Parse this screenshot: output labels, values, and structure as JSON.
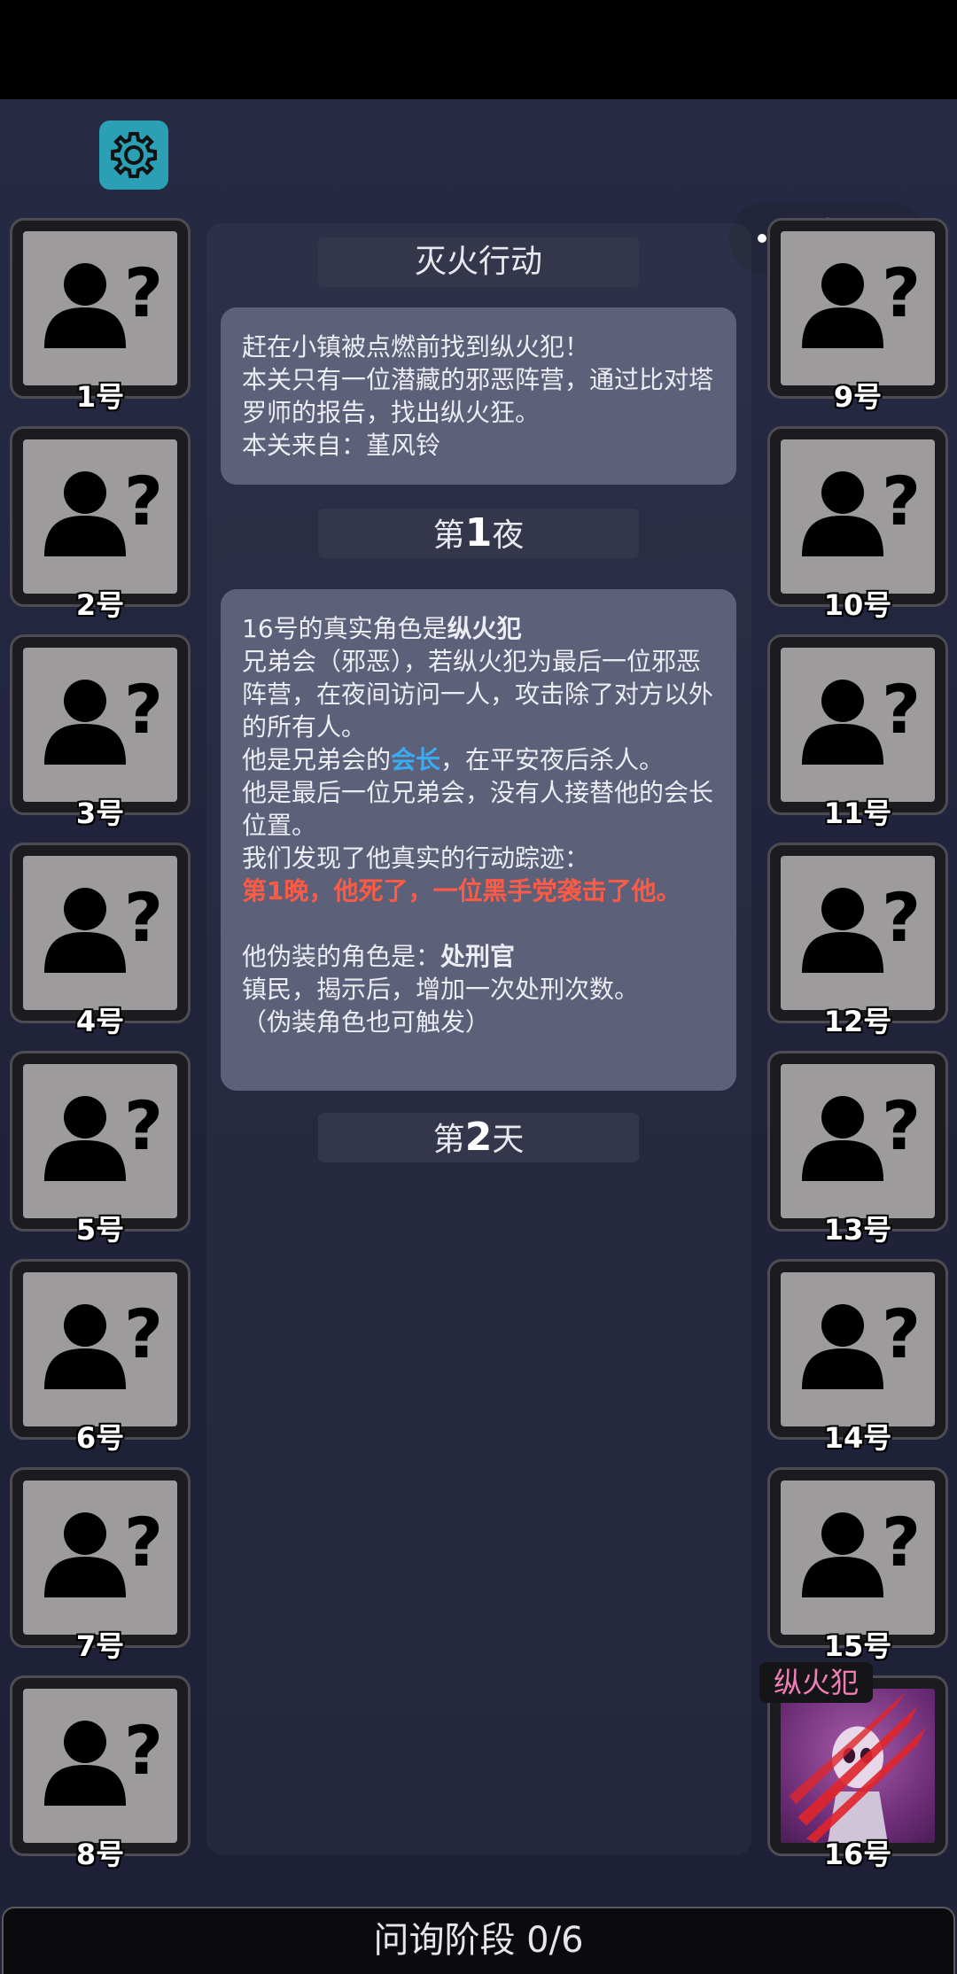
{
  "players_left": [
    {
      "label": "1号"
    },
    {
      "label": "2号"
    },
    {
      "label": "3号"
    },
    {
      "label": "4号"
    },
    {
      "label": "5号"
    },
    {
      "label": "6号"
    },
    {
      "label": "7号"
    },
    {
      "label": "8号"
    }
  ],
  "players_right": [
    {
      "label": "9号"
    },
    {
      "label": "10号"
    },
    {
      "label": "11号"
    },
    {
      "label": "12号"
    },
    {
      "label": "13号"
    },
    {
      "label": "14号"
    },
    {
      "label": "15号"
    },
    {
      "label": "16号",
      "revealed_role": "纵火犯"
    }
  ],
  "level": {
    "title": "灭火行动",
    "intro_lines": [
      "赶在小镇被点燃前找到纵火犯！",
      "本关只有一位潜藏的邪恶阵营，通过比对塔罗师的报告，找出纵火狂。",
      "本关来自：堇风铃"
    ]
  },
  "night1": {
    "prefix": "第",
    "number": "1",
    "suffix": "夜",
    "reveal_prefix": "16号的真实角色是",
    "reveal_role": "纵火犯",
    "role_desc": "兄弟会（邪恶），若纵火犯为最后一位邪恶阵营，在夜间访问一人，攻击除了对方以外的所有人。",
    "leader_prefix": "他是兄弟会的",
    "leader_word": "会长",
    "leader_suffix": "，在平安夜后杀人。",
    "last_member": "他是最后一位兄弟会，没有人接替他的会长位置。",
    "found_track": "我们发现了他真实的行动踪迹：",
    "track_event": "第1晚，他死了，一位黑手党袭击了他。",
    "disguise_prefix": "他伪装的角色是：",
    "disguise_role": "处刑官",
    "disguise_desc": "镇民，揭示后，增加一次处刑次数。",
    "disguise_note": "（伪装角色也可触发）"
  },
  "day2": {
    "prefix": "第",
    "number": "2",
    "suffix": "天"
  },
  "bottom": {
    "phase_text": "问询阶段 0/6"
  },
  "colors": {
    "accent_blue": "#3aaaf2",
    "accent_red": "#ff5a44",
    "role_tag": "#f07fb6",
    "settings_btn": "#2ba0b4"
  },
  "icons": {
    "settings": "gear-icon",
    "capsule_left": "more-dots-icon",
    "capsule_right": "target-circle-icon",
    "unknown_player": "unknown-person-icon"
  }
}
